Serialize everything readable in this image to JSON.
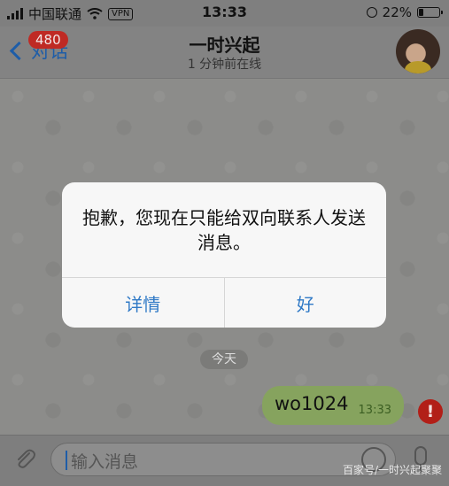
{
  "status_bar": {
    "carrier": "中国联通",
    "vpn": "VPN",
    "time": "13:33",
    "battery_text": "22%",
    "battery_level": 0.22
  },
  "nav": {
    "back_label": "对话",
    "unread_badge": "480",
    "title": "一时兴起",
    "subtitle": "1 分钟前在线"
  },
  "chat": {
    "date_separator": "今天",
    "messages": [
      {
        "text": "wo1024",
        "time": "13:33",
        "status_icon": "!"
      }
    ]
  },
  "input": {
    "placeholder": "输入消息"
  },
  "alert": {
    "message": "抱歉，您现在只能给双向联系人发送消息。",
    "details_button": "详情",
    "ok_button": "好"
  },
  "watermark": "百家号/一时兴起聚聚",
  "colors": {
    "accent": "#2f79c6",
    "badge": "#bf2a24",
    "bubble": "#86a35e",
    "error": "#b21f18"
  }
}
